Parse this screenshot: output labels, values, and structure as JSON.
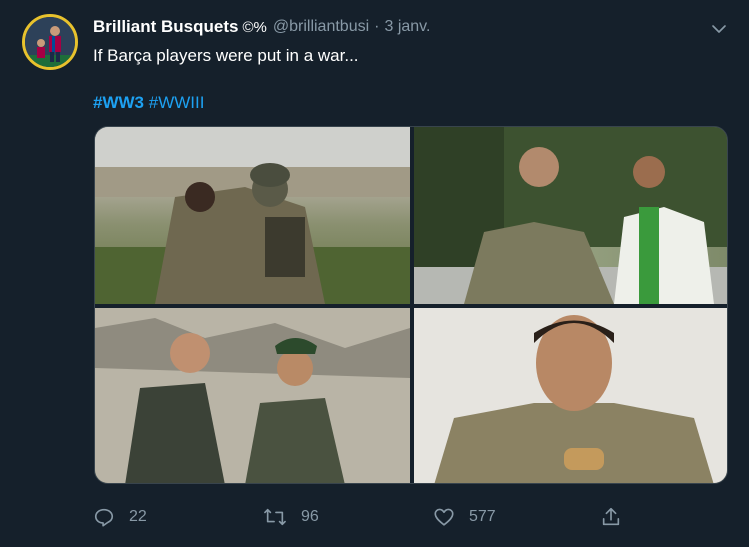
{
  "tweet": {
    "display_name": "Brilliant Busquets",
    "badge_text": "©%",
    "handle": "@brilliantbusi",
    "separator": "·",
    "date": "3 janv.",
    "text": "If Barça players were put in a war...",
    "hashtags": [
      "#WW3",
      "#WWIII"
    ]
  },
  "actions": {
    "reply_count": "22",
    "retweet_count": "96",
    "like_count": "577"
  },
  "icons": {
    "reply": "reply-icon",
    "retweet": "retweet-icon",
    "like": "heart-icon",
    "share": "share-icon",
    "more": "chevron-down-icon"
  },
  "colors": {
    "background": "#15202b",
    "link": "#1da1f2",
    "muted": "#8899a6",
    "avatar_ring": "#e8c22d"
  }
}
